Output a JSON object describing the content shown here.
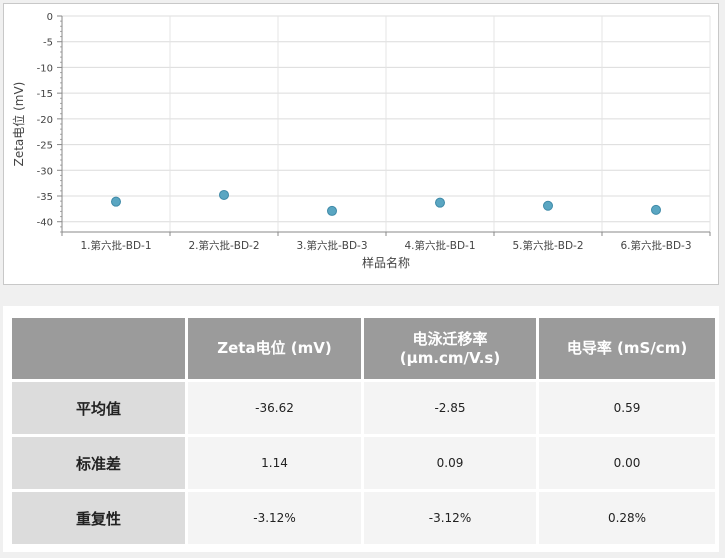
{
  "chart_data": {
    "type": "scatter",
    "categories": [
      "1.第六批-BD-1",
      "2.第六批-BD-2",
      "3.第六批-BD-3",
      "4.第六批-BD-1",
      "5.第六批-BD-2",
      "6.第六批-BD-3"
    ],
    "values": [
      -36.1,
      -34.8,
      -37.9,
      -36.3,
      -36.9,
      -37.7
    ],
    "xlabel": "样品名称",
    "ylabel": "Zeta电位 (mV)",
    "ylim": [
      -42,
      0
    ],
    "yticks": [
      0,
      -5,
      -10,
      -15,
      -20,
      -25,
      -30,
      -35,
      -40
    ],
    "grid": true,
    "marker_color": "#5aa6c2"
  },
  "stats_table": {
    "header": [
      "",
      "Zeta电位 (mV)",
      "电泳迁移率\n(µm.cm/V.s)",
      "电导率 (mS/cm)"
    ],
    "rows": [
      {
        "label": "平均值",
        "values": [
          "-36.62",
          "-2.85",
          "0.59"
        ]
      },
      {
        "label": "标准差",
        "values": [
          "1.14",
          "0.09",
          "0.00"
        ]
      },
      {
        "label": "重复性",
        "values": [
          "-3.12%",
          "-3.12%",
          "0.28%"
        ]
      }
    ]
  }
}
